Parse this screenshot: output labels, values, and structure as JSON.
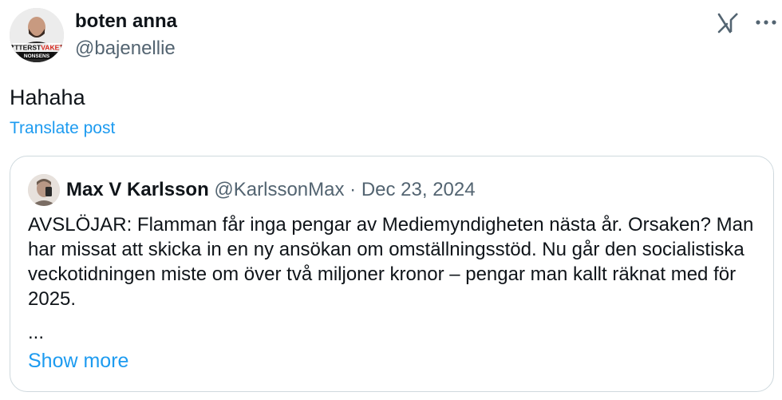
{
  "post": {
    "author": {
      "display_name": "boten anna",
      "handle": "@bajenellie",
      "avatar_badge_top": "YTTERSTVAKET",
      "avatar_badge_bottom": "NONSENS"
    },
    "text": "Hahaha",
    "translate_label": "Translate post",
    "icons": {
      "platform": "grok-icon",
      "more": "more-icon"
    }
  },
  "quote": {
    "author": {
      "display_name": "Max V Karlsson",
      "handle": "@KarlssonMax",
      "separator": "·",
      "date": "Dec 23, 2024"
    },
    "text": "AVSLÖJAR: Flamman får inga pengar av Mediemyndigheten nästa år. Orsaken? Man har missat att skicka in en ny ansökan om omställningsstöd. Nu går den socialistiska veckotidningen miste om över två miljoner kronor – pengar man kallt räknat med för 2025.",
    "ellipsis": "...",
    "show_more_label": "Show more"
  },
  "colors": {
    "link": "#1d9bf0",
    "secondary_text": "#536471",
    "border": "#cfd9de",
    "primary_text": "#0f1419",
    "badge_red": "#d8261c"
  }
}
